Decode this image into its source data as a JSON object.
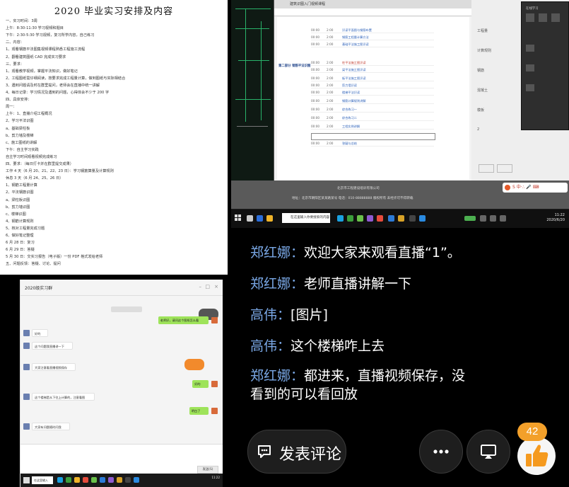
{
  "document": {
    "title": "2020 毕业实习安排及内容",
    "lines": [
      "一、实习时间：3周",
      "上午：8:30-11:30 学习视频和题目",
      "下午：2:30-5:30 学习视频，复习所学内容，自己练习",
      "二、内容：",
      "1、观看钢筋平法图集视频课程熟悉工程施工流程",
      "2、翻看建筑图纸 CAD 完成实习要求",
      "三、要求：",
      "1、观看教学视频，掌握平法知识，做好笔记",
      "2、工程图纸需仔细阅读，按要求完成工程量计算，做到图纸与实际相结合",
      "3、遇到问题请及时在群里提问，老师会在直播中统一讲解",
      "4、每日记录：学习情况及遇到的问题，心得体会不少于 200 字",
      "四、具体安排：",
      "周一：",
      "上午：1、直播介绍工程概况",
      "      2、学习平法识图",
      "        a、基础梁柱板",
      "        b、剪力墙及楼梯",
      "        c、施工图纸的讲解",
      "下午：自主学习实践",
      "自主学习时间观看视频完成练习",
      "四、要求：（每日打卡并在群里提交成果）",
      "工作 4 天（6 月 20、21、22、23 日）：学习钢筋算量及计算规则",
      "休息 3 天（6 月 24、25、26 日）",
      "1、钢筋工程量计算",
      "2、平法钢筋识图",
      "a、梁柱板识图",
      "b、剪力墙识图",
      "c、楼梯识图",
      "4、钢筋计算规则",
      "5、核对工程量完成习题",
      "6、做好笔记整理",
      "6 月 28 日：复习",
      "6 月 29 日：答疑",
      "5 月 30 日：交实习报告（电子版）一份 PDF 格式发给老师",
      "五、问题反馈：答疑、讨论、提问"
    ]
  },
  "desktop": {
    "browser_tab": "建筑识图入门视频课程",
    "section_label": "第二部分 钢筋平法识图",
    "rows": [
      {
        "t": "00:00",
        "n": "2:00",
        "label": "识读平面图与钢筋布置"
      },
      {
        "t": "00:00",
        "n": "2:00",
        "label": "钢筋工程量计算方法"
      },
      {
        "t": "00:00",
        "n": "2:00",
        "label": "基础平法施工图识读"
      },
      {
        "t": "00:00",
        "n": "2:00",
        "label": "柱平法施工图识读"
      },
      {
        "t": "00:00",
        "n": "2:00",
        "label": "梁平法施工图识读"
      },
      {
        "t": "00:00",
        "n": "2:00",
        "label": "板平法施工图识读"
      },
      {
        "t": "00:00",
        "n": "2:00",
        "label": "剪力墙识读"
      },
      {
        "t": "00:00",
        "n": "2:00",
        "label": "楼梯平法识读"
      },
      {
        "t": "00:00",
        "n": "2:00",
        "label": "钢筋计算规则讲解"
      },
      {
        "t": "00:00",
        "n": "2:00",
        "label": "综合练习一"
      },
      {
        "t": "00:00",
        "n": "2:00",
        "label": "综合练习二"
      },
      {
        "t": "00:00",
        "n": "2:00",
        "label": "工程实例讲解"
      },
      {
        "t": "00:00",
        "n": "2:00",
        "label": "答疑与总结"
      }
    ],
    "footer_line1": "北京市工程建设培训有限公司",
    "footer_line2": "地址：北京市朝阳区某某路某号 电话：010-88888888 版权所有 未经许可不得转载",
    "right_panel_rows": [
      "工程量",
      "计算规则",
      "钢筋",
      "混凝土",
      "模板",
      "2"
    ],
    "dark_panel_title": "在线学习",
    "chip_label": "S 中·∴ 🎤 ⌨",
    "search_text": "在这里输入你要搜索的内容",
    "clock_time": "11:22",
    "clock_date": "2020/6/20"
  },
  "chat": {
    "window_title": "2020级实习群",
    "send_label": "发送(S)",
    "messages": [
      {
        "dir": "out",
        "text": "老师好，请问这个图纸怎么看"
      },
      {
        "dir": "in",
        "text": "好的"
      },
      {
        "dir": "in",
        "text": "这个问题我直播讲一下"
      },
      {
        "dir": "in",
        "text": "大家注意看直播视频保存"
      },
      {
        "dir": "out",
        "text": "好的"
      },
      {
        "dir": "in",
        "text": "这个楼梯是从下往上计算的，注意看图"
      },
      {
        "dir": "out",
        "text": "明白了"
      },
      {
        "dir": "in",
        "text": "大家有问题随时问我"
      }
    ],
    "taskbar_search": "在这里输入",
    "taskbar_clock": "11:22"
  },
  "comments": [
    {
      "user": "郑红娜",
      "text": "欢迎大家来观看直播“1”。"
    },
    {
      "user": "郑红娜",
      "text": "老师直播讲解一下"
    },
    {
      "user": "高伟",
      "text": "[图片]"
    },
    {
      "user": "高伟",
      "text": "这个楼梯咋上去"
    },
    {
      "user": "郑红娜",
      "text": "都进来，直播视频保存，没"
    },
    {
      "user": "",
      "text": "看到的可以看回放"
    }
  ],
  "bottom": {
    "comment_button": "发表评论",
    "more_icon": "ellipsis-icon",
    "screen_icon": "screen-cast-icon",
    "like_icon": "thumbs-up-icon",
    "like_count": "42"
  },
  "colors": {
    "username": "#7aa8e6",
    "like_badge": "#f3a02a",
    "like_thumb": "#f59a1f",
    "wechat_green": "#9ee35a"
  }
}
